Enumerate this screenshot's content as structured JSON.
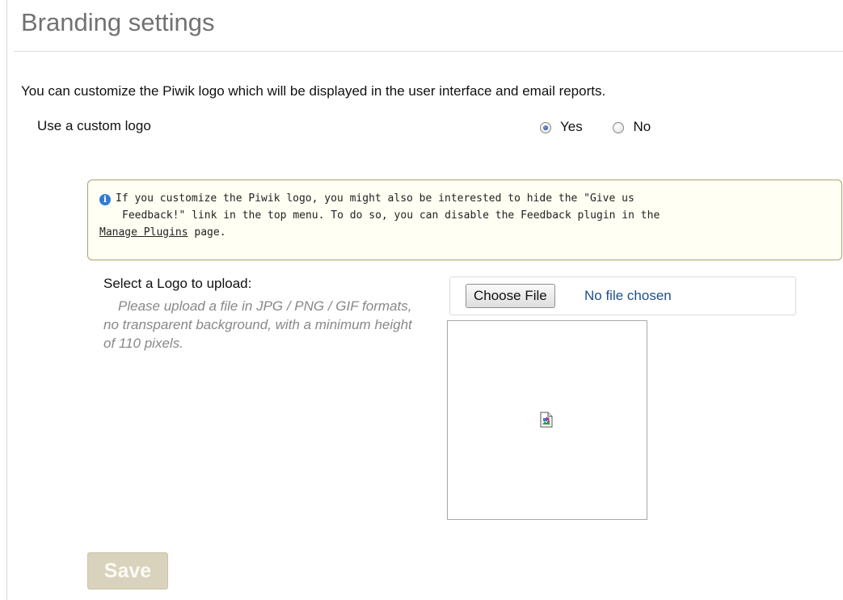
{
  "page": {
    "title": "Branding settings"
  },
  "intro_text": "You can customize the Piwik logo which will be displayed in the user interface and email reports.",
  "custom_logo": {
    "label": "Use a custom logo",
    "options": [
      {
        "label": "Yes",
        "checked": true
      },
      {
        "label": "No",
        "checked": false
      }
    ]
  },
  "notice": {
    "icon": "info-icon",
    "line1": "If you customize the Piwik logo, you might also be interested to hide the \"Give us",
    "line2": "Feedback!\" link in the top menu. To do so, you can disable the Feedback plugin in the",
    "link_text": "Manage Plugins",
    "after_link": " page.",
    "border_color": "#a9a474",
    "background_color": "#fffff3"
  },
  "upload": {
    "label": "Select a Logo to upload:",
    "help": "Please upload a file in JPG / PNG / GIF formats, no transparent background, with a minimum height of 110 pixels.",
    "button_label": "Choose File",
    "file_status": "No file chosen",
    "preview_icon": "broken-image-icon"
  },
  "save_label": "Save",
  "colors": {
    "title": "#727272",
    "save_button": "#d9d2bd",
    "radio_selected": "#2b5aa8"
  }
}
